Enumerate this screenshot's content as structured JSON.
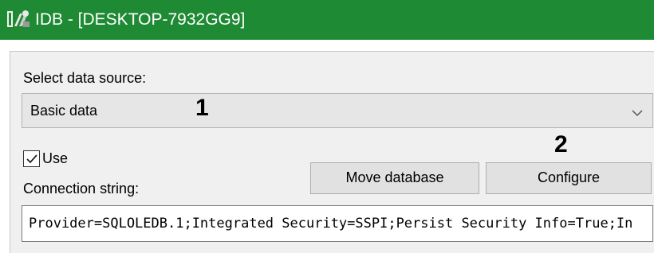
{
  "window": {
    "title": "IDB - [DESKTOP-7932GG9]",
    "icon": "idb-app-icon",
    "titlebar_color": "#1f8a34"
  },
  "form": {
    "select_source_label": "Select data source:",
    "data_source": {
      "value": "Basic data",
      "arrow_icon": "chevron-down-icon"
    },
    "use_checkbox": {
      "label": "Use",
      "checked": true
    },
    "connection_label": "Connection string:",
    "move_database_button": "Move database",
    "configure_button": "Configure",
    "connection_string": "Provider=SQLOLEDB.1;Integrated Security=SSPI;Persist Security Info=True;In"
  },
  "annotations": {
    "marker_1": "1",
    "marker_2": "2"
  }
}
